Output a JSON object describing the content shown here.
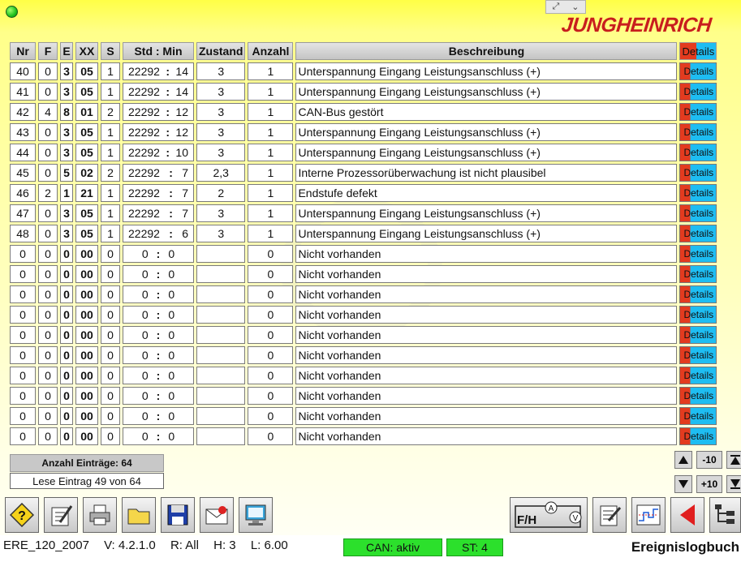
{
  "header": {
    "brand": "JUNGHEINRICH",
    "window_controls": [
      "⤢",
      "⌄"
    ]
  },
  "table": {
    "columns": [
      "Nr",
      "F",
      "E",
      "XX",
      "S",
      "Std : Min",
      "Zustand",
      "Anzahl",
      "Beschreibung",
      "Details"
    ],
    "row_button_label": "Details",
    "rows": [
      {
        "nr": "40",
        "f": "0",
        "e": "3",
        "xx": "05",
        "s": "1",
        "hours": "22292",
        "min": "14",
        "zustand": "3",
        "anzahl": "1",
        "desc": "Unterspannung Eingang Leistungsanschluss (+)"
      },
      {
        "nr": "41",
        "f": "0",
        "e": "3",
        "xx": "05",
        "s": "1",
        "hours": "22292",
        "min": "14",
        "zustand": "3",
        "anzahl": "1",
        "desc": "Unterspannung Eingang Leistungsanschluss (+)"
      },
      {
        "nr": "42",
        "f": "4",
        "e": "8",
        "xx": "01",
        "s": "2",
        "hours": "22292",
        "min": "12",
        "zustand": "3",
        "anzahl": "1",
        "desc": "CAN-Bus gestört"
      },
      {
        "nr": "43",
        "f": "0",
        "e": "3",
        "xx": "05",
        "s": "1",
        "hours": "22292",
        "min": "12",
        "zustand": "3",
        "anzahl": "1",
        "desc": "Unterspannung Eingang Leistungsanschluss (+)"
      },
      {
        "nr": "44",
        "f": "0",
        "e": "3",
        "xx": "05",
        "s": "1",
        "hours": "22292",
        "min": "10",
        "zustand": "3",
        "anzahl": "1",
        "desc": "Unterspannung Eingang Leistungsanschluss (+)"
      },
      {
        "nr": "45",
        "f": "0",
        "e": "5",
        "xx": "02",
        "s": "2",
        "hours": "22292",
        "min": "7",
        "zustand": "2,3",
        "anzahl": "1",
        "desc": "Interne Prozessorüberwachung ist nicht plausibel"
      },
      {
        "nr": "46",
        "f": "2",
        "e": "1",
        "xx": "21",
        "s": "1",
        "hours": "22292",
        "min": "7",
        "zustand": "2",
        "anzahl": "1",
        "desc": "Endstufe defekt"
      },
      {
        "nr": "47",
        "f": "0",
        "e": "3",
        "xx": "05",
        "s": "1",
        "hours": "22292",
        "min": "7",
        "zustand": "3",
        "anzahl": "1",
        "desc": "Unterspannung Eingang Leistungsanschluss (+)"
      },
      {
        "nr": "48",
        "f": "0",
        "e": "3",
        "xx": "05",
        "s": "1",
        "hours": "22292",
        "min": "6",
        "zustand": "3",
        "anzahl": "1",
        "desc": "Unterspannung Eingang Leistungsanschluss (+)"
      },
      {
        "nr": "0",
        "f": "0",
        "e": "0",
        "xx": "00",
        "s": "0",
        "hours": "0",
        "min": "0",
        "zustand": "",
        "anzahl": "0",
        "desc": "Nicht vorhanden"
      },
      {
        "nr": "0",
        "f": "0",
        "e": "0",
        "xx": "00",
        "s": "0",
        "hours": "0",
        "min": "0",
        "zustand": "",
        "anzahl": "0",
        "desc": "Nicht vorhanden"
      },
      {
        "nr": "0",
        "f": "0",
        "e": "0",
        "xx": "00",
        "s": "0",
        "hours": "0",
        "min": "0",
        "zustand": "",
        "anzahl": "0",
        "desc": "Nicht vorhanden"
      },
      {
        "nr": "0",
        "f": "0",
        "e": "0",
        "xx": "00",
        "s": "0",
        "hours": "0",
        "min": "0",
        "zustand": "",
        "anzahl": "0",
        "desc": "Nicht vorhanden"
      },
      {
        "nr": "0",
        "f": "0",
        "e": "0",
        "xx": "00",
        "s": "0",
        "hours": "0",
        "min": "0",
        "zustand": "",
        "anzahl": "0",
        "desc": "Nicht vorhanden"
      },
      {
        "nr": "0",
        "f": "0",
        "e": "0",
        "xx": "00",
        "s": "0",
        "hours": "0",
        "min": "0",
        "zustand": "",
        "anzahl": "0",
        "desc": "Nicht vorhanden"
      },
      {
        "nr": "0",
        "f": "0",
        "e": "0",
        "xx": "00",
        "s": "0",
        "hours": "0",
        "min": "0",
        "zustand": "",
        "anzahl": "0",
        "desc": "Nicht vorhanden"
      },
      {
        "nr": "0",
        "f": "0",
        "e": "0",
        "xx": "00",
        "s": "0",
        "hours": "0",
        "min": "0",
        "zustand": "",
        "anzahl": "0",
        "desc": "Nicht vorhanden"
      },
      {
        "nr": "0",
        "f": "0",
        "e": "0",
        "xx": "00",
        "s": "0",
        "hours": "0",
        "min": "0",
        "zustand": "",
        "anzahl": "0",
        "desc": "Nicht vorhanden"
      },
      {
        "nr": "0",
        "f": "0",
        "e": "0",
        "xx": "00",
        "s": "0",
        "hours": "0",
        "min": "0",
        "zustand": "",
        "anzahl": "0",
        "desc": "Nicht vorhanden"
      }
    ]
  },
  "summary": {
    "entries_label": "Anzahl Einträge: 64",
    "reading_label": "Lese Eintrag 49  von 64"
  },
  "navigation": {
    "minus10": "-10",
    "plus10": "+10"
  },
  "toolbar": {
    "icons": [
      "help-icon",
      "edit-icon",
      "print-icon",
      "folder-icon",
      "save-icon",
      "mail-icon",
      "monitor-icon"
    ],
    "fh_label": "F/H"
  },
  "footer": {
    "program": "ERE_120_2007",
    "version": "V: 4.2.1.0",
    "r": "R: All",
    "h": "H: 3",
    "l": "L: 6.00",
    "can_status": "CAN: aktiv",
    "st": "ST: 4",
    "mode_title": "Ereignislogbuch"
  },
  "colors": {
    "background_top": "#ffff46",
    "details_red": "#e33b1f",
    "details_cyan": "#1ebdf2",
    "status_green": "#2ce02c",
    "brand_red": "#c81e1e"
  }
}
